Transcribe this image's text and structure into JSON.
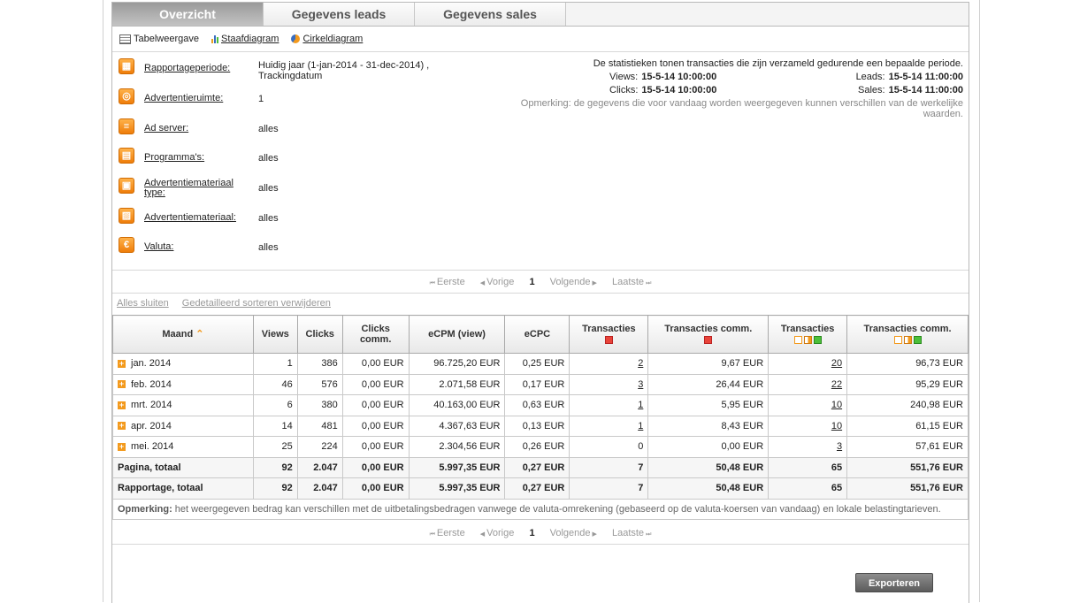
{
  "tabs": [
    {
      "label": "Overzicht",
      "active": true
    },
    {
      "label": "Gegevens leads",
      "active": false
    },
    {
      "label": "Gegevens sales",
      "active": false
    }
  ],
  "views": {
    "table_label": "Tabelweergave",
    "bar_label": "Staafdiagram",
    "pie_label": "Cirkeldiagram"
  },
  "filters": [
    {
      "label": "Rapportageperiode:",
      "value": "Huidig jaar (1-jan-2014 - 31-dec-2014) , Trackingdatum",
      "icon": "calendar-icon"
    },
    {
      "label": "Advertentieruimte:",
      "value": "1",
      "icon": "space-icon"
    },
    {
      "label": "Ad server:",
      "value": "alles",
      "icon": "server-icon"
    },
    {
      "label": "Programma's:",
      "value": "alles",
      "icon": "program-icon"
    },
    {
      "label": "Advertentiemateriaal type:",
      "value": "alles",
      "icon": "material-type-icon"
    },
    {
      "label": "Advertentiemateriaal:",
      "value": "alles",
      "icon": "material-icon"
    },
    {
      "label": "Valuta:",
      "value": "alles",
      "icon": "euro-icon"
    }
  ],
  "stats": {
    "intro": "De statistieken tonen transacties die zijn verzameld gedurende een bepaalde periode.",
    "views_label": "Views:",
    "views_value": "15-5-14 10:00:00",
    "clicks_label": "Clicks:",
    "clicks_value": "15-5-14 10:00:00",
    "leads_label": "Leads:",
    "leads_value": "15-5-14 11:00:00",
    "sales_label": "Sales:",
    "sales_value": "15-5-14 11:00:00",
    "note": "Opmerking: de gegevens die voor vandaag worden weergegeven kunnen verschillen van de werkelijke waarden."
  },
  "pager": {
    "first": "Eerste",
    "prev": "Vorige",
    "current": "1",
    "next": "Volgende",
    "last": "Laatste"
  },
  "sort_links": {
    "close_all": "Alles sluiten",
    "remove_sort": "Gedetailleerd sorteren verwijderen"
  },
  "table": {
    "headers": {
      "month": "Maand",
      "views": "Views",
      "clicks": "Clicks",
      "clicks_comm": "Clicks comm.",
      "ecpm": "eCPM (view)",
      "ecpc": "eCPC",
      "transactions_a": "Transacties",
      "transactions_comm_a": "Transacties comm.",
      "transactions_b": "Transacties",
      "transactions_comm_b": "Transacties comm."
    },
    "rows": [
      {
        "month": "jan. 2014",
        "views": "1",
        "clicks": "386",
        "clicks_comm": "0,00 EUR",
        "ecpm": "96.725,20 EUR",
        "ecpc": "0,25 EUR",
        "trans_a": "2",
        "trans_comm_a": "9,67 EUR",
        "trans_b": "20",
        "trans_comm_b": "96,73 EUR"
      },
      {
        "month": "feb. 2014",
        "views": "46",
        "clicks": "576",
        "clicks_comm": "0,00 EUR",
        "ecpm": "2.071,58 EUR",
        "ecpc": "0,17 EUR",
        "trans_a": "3",
        "trans_comm_a": "26,44 EUR",
        "trans_b": "22",
        "trans_comm_b": "95,29 EUR"
      },
      {
        "month": "mrt. 2014",
        "views": "6",
        "clicks": "380",
        "clicks_comm": "0,00 EUR",
        "ecpm": "40.163,00 EUR",
        "ecpc": "0,63 EUR",
        "trans_a": "1",
        "trans_comm_a": "5,95 EUR",
        "trans_b": "10",
        "trans_comm_b": "240,98 EUR"
      },
      {
        "month": "apr. 2014",
        "views": "14",
        "clicks": "481",
        "clicks_comm": "0,00 EUR",
        "ecpm": "4.367,63 EUR",
        "ecpc": "0,13 EUR",
        "trans_a": "1",
        "trans_comm_a": "8,43 EUR",
        "trans_b": "10",
        "trans_comm_b": "61,15 EUR"
      },
      {
        "month": "mei. 2014",
        "views": "25",
        "clicks": "224",
        "clicks_comm": "0,00 EUR",
        "ecpm": "2.304,56 EUR",
        "ecpc": "0,26 EUR",
        "trans_a": "0",
        "trans_comm_a": "0,00 EUR",
        "trans_b": "3",
        "trans_comm_b": "57,61 EUR"
      }
    ],
    "page_total": {
      "label": "Pagina, totaal",
      "views": "92",
      "clicks": "2.047",
      "clicks_comm": "0,00 EUR",
      "ecpm": "5.997,35 EUR",
      "ecpc": "0,27 EUR",
      "trans_a": "7",
      "trans_comm_a": "50,48 EUR",
      "trans_b": "65",
      "trans_comm_b": "551,76 EUR"
    },
    "report_total": {
      "label": "Rapportage, totaal",
      "views": "92",
      "clicks": "2.047",
      "clicks_comm": "0,00 EUR",
      "ecpm": "5.997,35 EUR",
      "ecpc": "0,27 EUR",
      "trans_a": "7",
      "trans_comm_a": "50,48 EUR",
      "trans_b": "65",
      "trans_comm_b": "551,76 EUR"
    },
    "note_label": "Opmerking:",
    "note_text": "het weergegeven bedrag kan verschillen met de uitbetalingsbedragen vanwege de valuta-omrekening (gebaseerd op de valuta-koersen van vandaag) en lokale belastingtarieven."
  },
  "export_label": "Exporteren",
  "colors": {
    "accent": "#f39a1d",
    "tab_active": "#a8a8a8",
    "status_red": "#e8443a",
    "status_green": "#4cbf3a"
  }
}
